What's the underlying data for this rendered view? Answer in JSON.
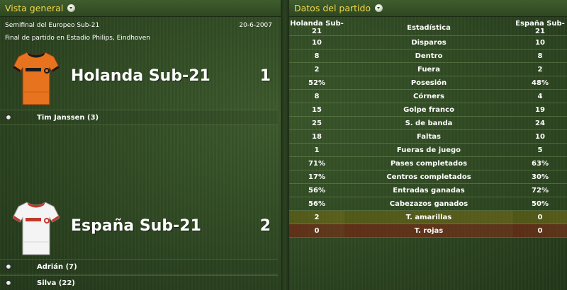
{
  "left_panel": {
    "title": "Vista general",
    "competition": "Semifinal del Europeo Sub-21",
    "date": "20-6-2007",
    "venue": "Final de partido en Estadio Philips, Eindhoven",
    "home": {
      "name": "Holanda Sub-21",
      "score": "1",
      "shirt_color": "#e8731e",
      "shirt_trim": "#1a1a1a",
      "scorers": [
        "Tim Janssen (3)"
      ]
    },
    "away": {
      "name": "España Sub-21",
      "score": "2",
      "shirt_color": "#f4f4f4",
      "shirt_trim": "#c0392b",
      "scorers": [
        "Adrián (7)",
        "Silva (22)"
      ]
    }
  },
  "right_panel": {
    "title": "Datos del partido",
    "headers": {
      "home": "Holanda Sub-21",
      "stat": "Estadística",
      "away": "España Sub-21"
    },
    "rows": [
      {
        "home": "10",
        "stat": "Disparos",
        "away": "10"
      },
      {
        "home": "8",
        "stat": "Dentro",
        "away": "8"
      },
      {
        "home": "2",
        "stat": "Fuera",
        "away": "2"
      },
      {
        "home": "52%",
        "stat": "Posesión",
        "away": "48%"
      },
      {
        "home": "8",
        "stat": "Córners",
        "away": "4"
      },
      {
        "home": "15",
        "stat": "Golpe franco",
        "away": "19"
      },
      {
        "home": "25",
        "stat": "S. de banda",
        "away": "24"
      },
      {
        "home": "18",
        "stat": "Faltas",
        "away": "10"
      },
      {
        "home": "1",
        "stat": "Fueras de juego",
        "away": "5"
      },
      {
        "home": "71%",
        "stat": "Pases completados",
        "away": "63%"
      },
      {
        "home": "17%",
        "stat": "Centros completados",
        "away": "30%"
      },
      {
        "home": "56%",
        "stat": "Entradas ganadas",
        "away": "72%"
      },
      {
        "home": "56%",
        "stat": "Cabezazos ganados",
        "away": "50%"
      },
      {
        "home": "2",
        "stat": "T. amarillas",
        "away": "0"
      },
      {
        "home": "0",
        "stat": "T. rojas",
        "away": "0"
      }
    ]
  },
  "colors": {
    "header_title": "#f2d84a",
    "yellow_card_row": "#6e6a1c",
    "red_card_row": "#6b2e18"
  },
  "icons": {
    "header_menu": "dropdown-dot-icon",
    "goal": "ball-icon"
  }
}
